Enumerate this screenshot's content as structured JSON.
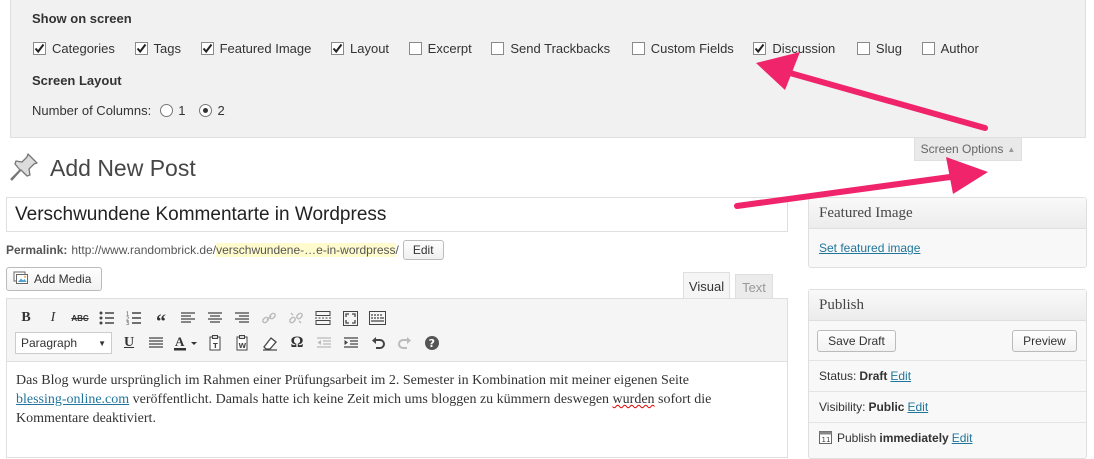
{
  "screen_options": {
    "show_heading": "Show on screen",
    "checkboxes": [
      {
        "label": "Categories",
        "checked": true
      },
      {
        "label": "Tags",
        "checked": true
      },
      {
        "label": "Featured Image",
        "checked": true
      },
      {
        "label": "Layout",
        "checked": true
      },
      {
        "label": "Excerpt",
        "checked": false
      },
      {
        "label": "Send Trackbacks",
        "checked": false
      },
      {
        "label": "Custom Fields",
        "checked": false
      },
      {
        "label": "Discussion",
        "checked": true
      },
      {
        "label": "Slug",
        "checked": false
      },
      {
        "label": "Author",
        "checked": false
      }
    ],
    "layout_heading": "Screen Layout",
    "columns_label": "Number of Columns:",
    "column_options": [
      "1",
      "2"
    ],
    "selected_columns": "2",
    "tab_label": "Screen Options",
    "tab_arrow": "▲"
  },
  "page": {
    "title": "Add New Post",
    "title_icon": "pushpin-icon"
  },
  "post": {
    "title_value": "Verschwundene Kommentarte in Wordpress",
    "permalink_label": "Permalink:",
    "permalink_base": "http://www.randombrick.de/",
    "permalink_slug": "verschwundene-…e-in-wordpress",
    "permalink_suffix": "/",
    "permalink_edit": "Edit",
    "add_media": "Add Media"
  },
  "editor": {
    "tab_visual": "Visual",
    "tab_text": "Text",
    "format_select": "Paragraph",
    "body_part1": "Das Blog wurde ursprünglich im Rahmen einer Prüfungsarbeit im 2. Semester in Kombination mit meiner eigenen Seite",
    "body_link": "blessing-online.com",
    "body_part2": " veröffentlicht. Damals hatte ich keine Zeit mich ums bloggen zu kümmern deswegen ",
    "body_misspelled": "wurden",
    "body_part3": " sofort die",
    "body_part4": "Kommentare deaktiviert."
  },
  "featured_image": {
    "title": "Featured Image",
    "link": "Set featured image"
  },
  "publish": {
    "title": "Publish",
    "save_draft": "Save Draft",
    "preview": "Preview",
    "status_label": "Status:",
    "status_value": "Draft",
    "visibility_label": "Visibility:",
    "visibility_value": "Public",
    "publish_label": "Publish",
    "publish_value": "immediately",
    "edit": "Edit"
  },
  "colors": {
    "arrow": "#f0246a",
    "link": "#21759b"
  }
}
